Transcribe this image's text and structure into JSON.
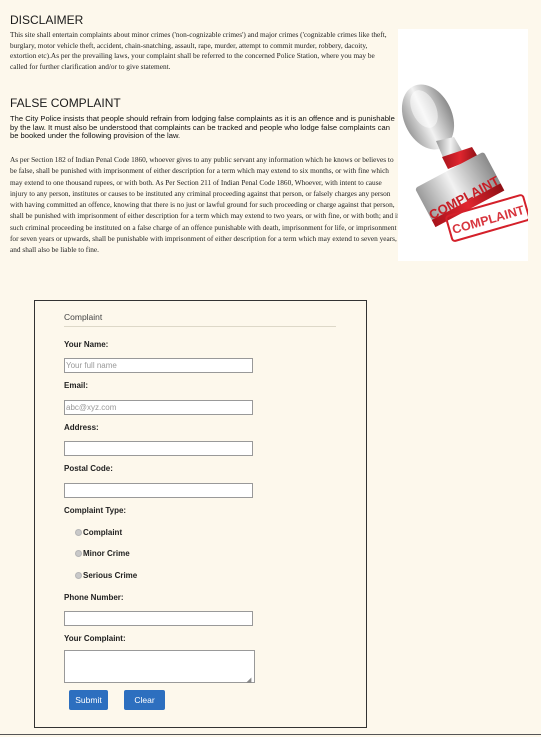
{
  "disclaimer": {
    "heading": "DISCLAIMER",
    "text": "This site shall entertain complaints about minor crimes ('non-cognizable crimes') and major crimes ('cognizable crimes like theft, burglary, motor vehicle theft, accident, chain-snatching, assault, rape, murder, attempt to commit murder, robbery, dacoity, extortion etc).As per the prevailing laws, your complaint shall be referred to the concerned Police Station, where you may be called for further clarification and/or to give statement."
  },
  "false_complaint": {
    "heading": "FALSE COMPLAINT",
    "lead": "The City Police insists that people should refrain from lodging false complaints as it is an offence and is punishable by the law. It must also be understood that complaints can be tracked and people who lodge false complaints can be booked under the following provision of the law.",
    "text": "As per Section 182 of Indian Penal Code 1860, whoever gives to any public servant any information which he knows or believes to be false, shall be punished with imprisonment of either description for a term which may extend to six months, or with fine which may extend to one thousand rupees, or with both. As Per Section 211 of Indian Penal Code 1860, Whoever, with intent to cause injury to any person, institutes or causes to be instituted any criminal proceeding against that person, or falsely charges any person with having committed an offence, knowing that there is no just or lawful ground for such proceeding or charge against that person, shall be punished with imprisonment of either description for a term which may extend to two years, or with fine, or with both; and if such criminal proceeding be instituted on a false charge of an offence punishable with death, imprisonment for life, or imprisonment for seven years or upwards, shall be punishable with imprisonment of either description for a term which may extend to seven years, and shall also be liable to fine."
  },
  "image": {
    "stamp_text": "COMPLAINT",
    "colors": {
      "stamp_red": "#d4202a",
      "handle": "#c8c8c8"
    }
  },
  "form": {
    "title": "Complaint",
    "name_label": "Your Name:",
    "name_placeholder": "Your full name",
    "email_label": "Email:",
    "email_placeholder": "abc@xyz.com",
    "address_label": "Address:",
    "postal_label": "Postal Code:",
    "type_label": "Complaint Type:",
    "type_options": [
      "Complaint",
      "Minor Crime",
      "Serious Crime"
    ],
    "phone_label": "Phone Number:",
    "complaint_label": "Your Complaint:",
    "submit_label": "Submit",
    "clear_label": "Clear"
  },
  "colors": {
    "background": "#fdf8ec",
    "button": "#2d6fbf"
  }
}
